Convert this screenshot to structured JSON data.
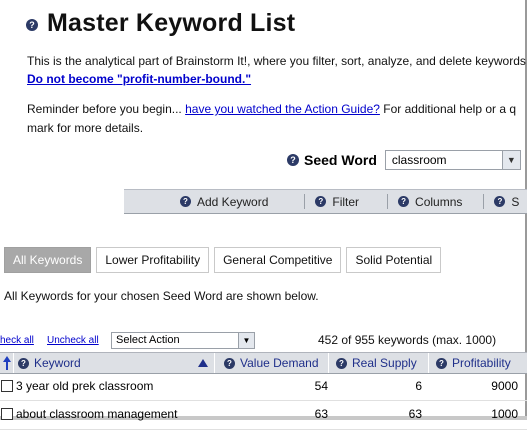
{
  "page": {
    "title": "Master Keyword List",
    "intro_text": "This is the analytical part of Brainstorm It!, where you filter, sort, analyze, and delete keywords",
    "intro_link": "Do not become \"profit-number-bound.\"",
    "reminder_prefix": "Reminder before you begin...",
    "reminder_link": "have you watched the Action Guide?",
    "reminder_suffix": "For additional help or a q",
    "reminder_line2": "mark for more details."
  },
  "seed": {
    "label": "Seed Word",
    "value": "classroom"
  },
  "toolbar": {
    "add_keyword": "Add Keyword",
    "filter": "Filter",
    "columns": "Columns",
    "s": "S"
  },
  "tabs": [
    {
      "label": "All Keywords",
      "active": true
    },
    {
      "label": "Lower Profitability",
      "active": false
    },
    {
      "label": "General Competitive",
      "active": false
    },
    {
      "label": "Solid Potential",
      "active": false
    }
  ],
  "tab_description": "All Keywords for your chosen Seed Word are shown below.",
  "actions": {
    "check_all": "heck all",
    "uncheck_all": "Uncheck all",
    "select_action": "Select Action",
    "count_text": "452 of 955 keywords (max. 1000)"
  },
  "table": {
    "columns": {
      "keyword": "Keyword",
      "value_demand": "Value Demand",
      "real_supply": "Real Supply",
      "profitability": "Profitability"
    },
    "rows": [
      {
        "keyword": "3 year old prek classroom",
        "value_demand": "54",
        "real_supply": "6",
        "profitability": "9000"
      },
      {
        "keyword": "about classroom management",
        "value_demand": "63",
        "real_supply": "63",
        "profitability": "1000"
      }
    ]
  },
  "colors": {
    "header_bg": "#dde0e5",
    "link": "#0000cc",
    "header_text": "#1f2f8a",
    "active_tab": "#a8a8a8"
  }
}
